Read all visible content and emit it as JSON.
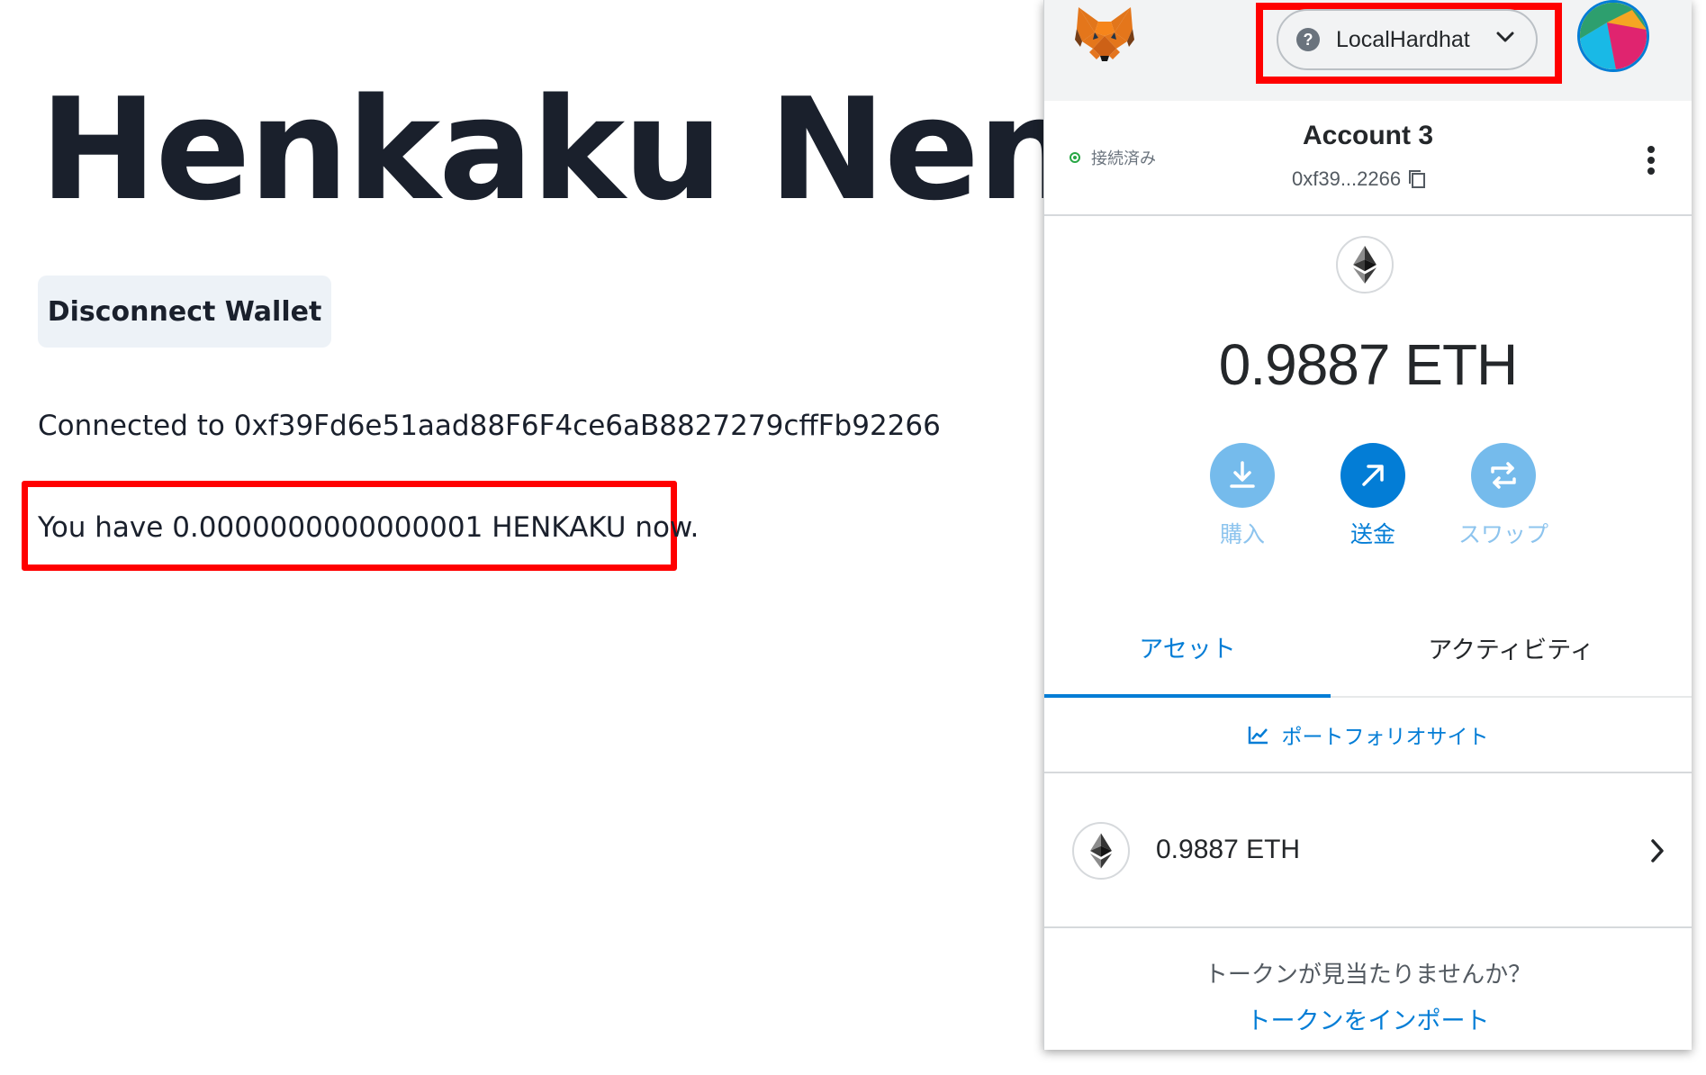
{
  "dapp": {
    "title": "Henkaku Nengaj",
    "disconnect_label": "Disconnect Wallet",
    "connected_text": "Connected to 0xf39Fd6e51aad88F6F4ce6aB8827279cffFb92266",
    "balance_text": "You have 0.0000000000000001 HENKAKU now."
  },
  "metamask": {
    "network": {
      "icon_glyph": "?",
      "label": "LocalHardhat"
    },
    "account": {
      "status": "接続済み",
      "name": "Account 3",
      "address": "0xf39...2266"
    },
    "balance": "0.9887 ETH",
    "actions": {
      "buy": "購入",
      "send": "送金",
      "swap": "スワップ"
    },
    "tabs": {
      "assets": "アセット",
      "activity": "アクティビティ"
    },
    "portfolio_link": "ポートフォリオサイト",
    "assets": [
      {
        "value": "0.9887 ETH"
      }
    ],
    "no_token_text": "トークンが見当たりませんか？",
    "import_link": "トークンをインポート"
  },
  "colors": {
    "accent": "#037dd6",
    "highlight": "#ff0000",
    "connected": "#28a745"
  }
}
